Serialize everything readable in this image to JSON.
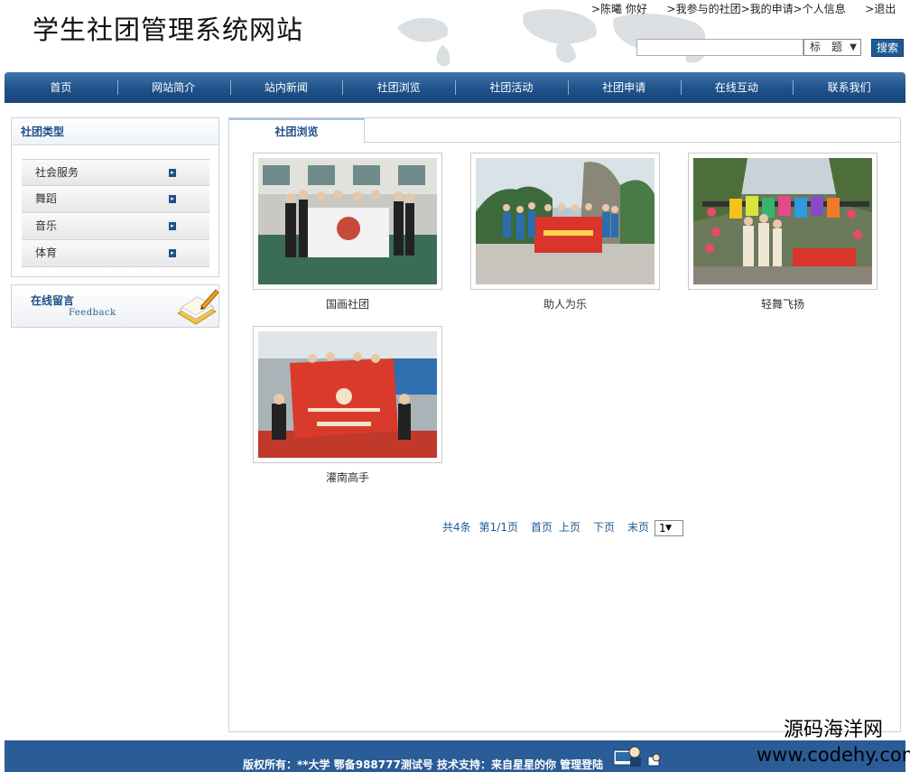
{
  "header": {
    "site_title": "学生社团管理系统网站",
    "user_greeting": ">陈曦 你好",
    "links": [
      ">我参与的社团",
      ">我的申请",
      ">个人信息",
      ">退出"
    ],
    "search": {
      "value": "",
      "select_value": "标　题",
      "button": "搜索"
    }
  },
  "nav": [
    "首页",
    "网站简介",
    "站内新闻",
    "社团浏览",
    "社团活动",
    "社团申请",
    "在线互动",
    "联系我们"
  ],
  "sidebar": {
    "title": "社团类型",
    "items": [
      "社会服务",
      "舞蹈",
      "音乐",
      "体育"
    ],
    "feedback_title": "在线留言",
    "feedback_sub": "Feedback"
  },
  "main": {
    "tab": "社团浏览",
    "clubs": [
      {
        "name": "国画社团",
        "photo": "gym-banner-photo"
      },
      {
        "name": "助人为乐",
        "photo": "volunteers-banner-photo"
      },
      {
        "name": "轻舞飞扬",
        "photo": "festival-booth-photo"
      },
      {
        "name": "灌南高手",
        "photo": "archery-club-photo"
      }
    ],
    "pager": {
      "total": "共4条",
      "page_info": "第1/1页",
      "first": "首页",
      "prev": "上页",
      "next": "下页",
      "last": "末页",
      "select_value": "1"
    }
  },
  "footer": {
    "text": "版权所有：**大学   鄂备988777测试号  技术支持：来自星星的你    管理登陆"
  },
  "watermark": {
    "line1": "源码海洋网",
    "line2": "www.codehy.com"
  },
  "colors": {
    "nav_blue": "#1f5189",
    "link_blue": "#1e5b96",
    "footer_blue": "#2a5c97"
  }
}
